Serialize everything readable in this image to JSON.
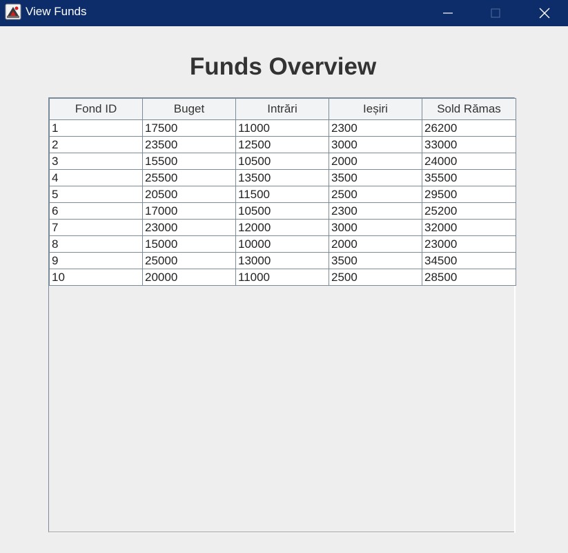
{
  "window": {
    "title": "View Funds",
    "titlebar_color": "#0c2d69",
    "icons": [
      "java-app-icon",
      "minimize-icon",
      "maximize-icon",
      "close-icon"
    ]
  },
  "page": {
    "heading": "Funds Overview"
  },
  "table": {
    "columns": [
      "Fond ID",
      "Buget",
      "Intrări",
      "Ieșiri",
      "Sold Rămas"
    ],
    "rows": [
      [
        "1",
        "17500",
        "11000",
        "2300",
        "26200"
      ],
      [
        "2",
        "23500",
        "12500",
        "3000",
        "33000"
      ],
      [
        "3",
        "15500",
        "10500",
        "2000",
        "24000"
      ],
      [
        "4",
        "25500",
        "13500",
        "3500",
        "35500"
      ],
      [
        "5",
        "20500",
        "11500",
        "2500",
        "29500"
      ],
      [
        "6",
        "17000",
        "10500",
        "2300",
        "25200"
      ],
      [
        "7",
        "23000",
        "12000",
        "3000",
        "32000"
      ],
      [
        "8",
        "15000",
        "10000",
        "2000",
        "23000"
      ],
      [
        "9",
        "25000",
        "13000",
        "3500",
        "34500"
      ],
      [
        "10",
        "20000",
        "11000",
        "2500",
        "28500"
      ]
    ]
  }
}
